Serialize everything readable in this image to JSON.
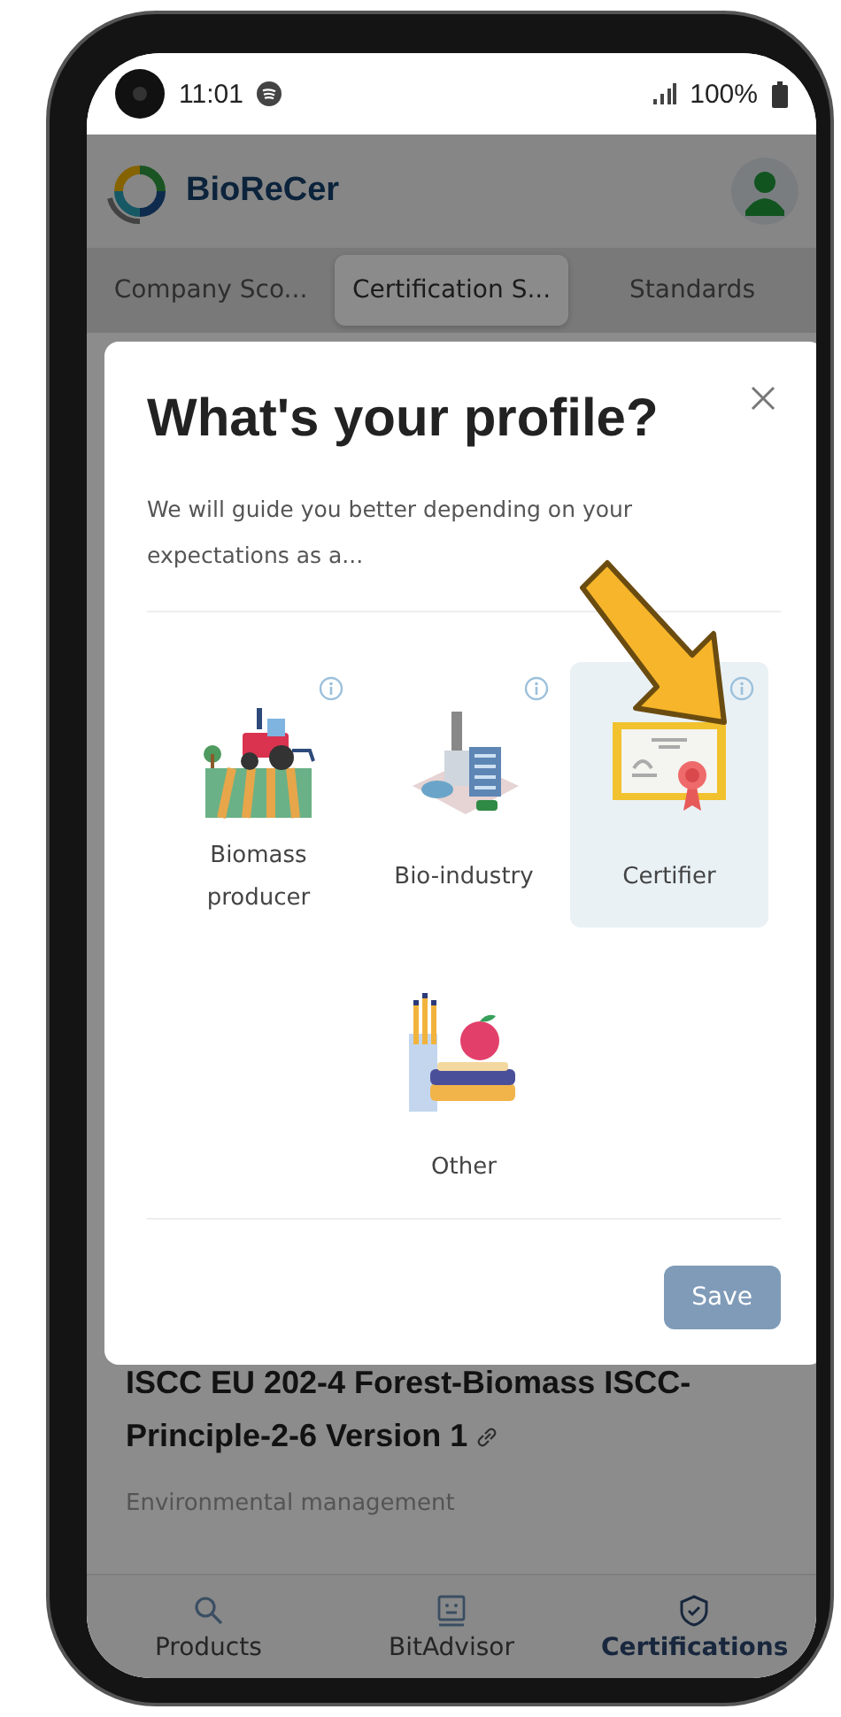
{
  "status_bar": {
    "time": "11:01",
    "battery": "100%"
  },
  "app_bar": {
    "brand": "BioReCer"
  },
  "tabs": [
    {
      "label": "Company Sco...",
      "selected": false
    },
    {
      "label": "Certification S...",
      "selected": true
    },
    {
      "label": "Standards",
      "selected": false
    }
  ],
  "content": {
    "title": "ISCC EU 202-4 Forest-Biomass ISCC-Principle-2-6 Version 1",
    "category": "Environmental management"
  },
  "dialog": {
    "title": "What's your profile?",
    "subtitle": "We will guide you better depending on your expectations as a...",
    "options": [
      {
        "kind": "farm",
        "label": "Biomass producer",
        "info": true,
        "selected": false
      },
      {
        "kind": "industry",
        "label": "Bio-industry",
        "info": true,
        "selected": false
      },
      {
        "kind": "certificate",
        "label": "Certifier",
        "info": true,
        "selected": true
      },
      {
        "kind": "other",
        "label": "Other",
        "info": false,
        "selected": false
      }
    ],
    "save": "Save"
  },
  "bottom_nav": [
    {
      "kind": "search",
      "label": "Products",
      "selected": false
    },
    {
      "kind": "robot",
      "label": "BitAdvisor",
      "selected": false
    },
    {
      "kind": "shield",
      "label": "Certifications",
      "selected": true
    }
  ]
}
